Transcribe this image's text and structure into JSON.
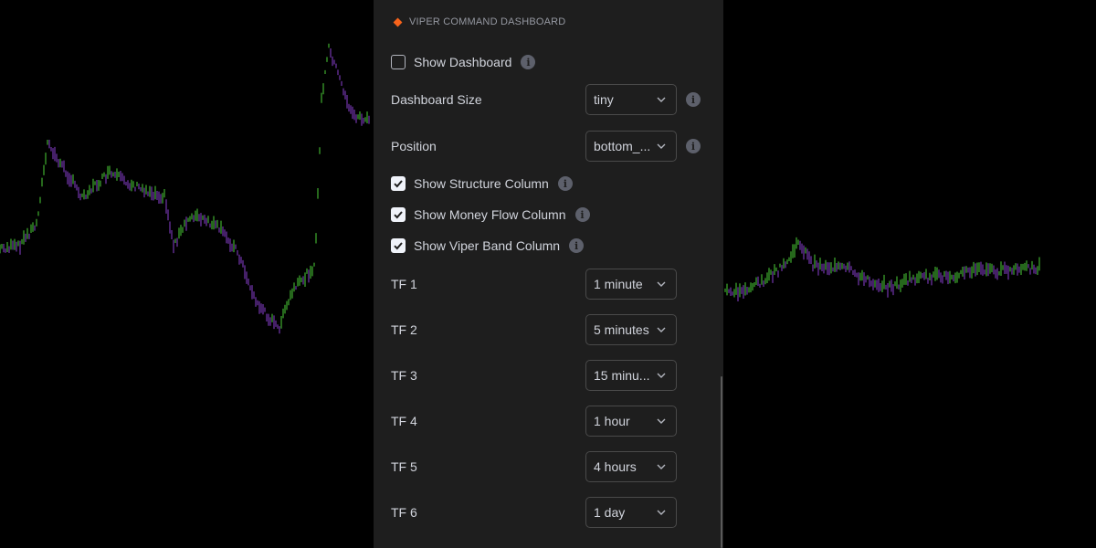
{
  "panel": {
    "section_title": "VIPER COMMAND DASHBOARD",
    "accent_color": "#f7631b",
    "show_dashboard": {
      "label": "Show Dashboard",
      "checked": false
    },
    "dashboard_size": {
      "label": "Dashboard Size",
      "value": "tiny"
    },
    "position": {
      "label": "Position",
      "value": "bottom_..."
    },
    "show_structure": {
      "label": "Show Structure Column",
      "checked": true
    },
    "show_money_flow": {
      "label": "Show Money Flow Column",
      "checked": true
    },
    "show_viper_band": {
      "label": "Show Viper Band Column",
      "checked": true
    },
    "timeframes": [
      {
        "label": "TF 1",
        "value": "1 minute"
      },
      {
        "label": "TF 2",
        "value": "5 minutes"
      },
      {
        "label": "TF 3",
        "value": "15 minu..."
      },
      {
        "label": "TF 4",
        "value": "1 hour"
      },
      {
        "label": "TF 5",
        "value": "4 hours"
      },
      {
        "label": "TF 6",
        "value": "1 day"
      }
    ]
  },
  "icons": {
    "info": "info-icon",
    "chevron": "chevron-down-icon",
    "check": "checkmark-icon",
    "header": "diamond-icon"
  },
  "chart_colors": {
    "up": "#4cd137",
    "down": "#8a3fd1",
    "background": "#000000"
  }
}
